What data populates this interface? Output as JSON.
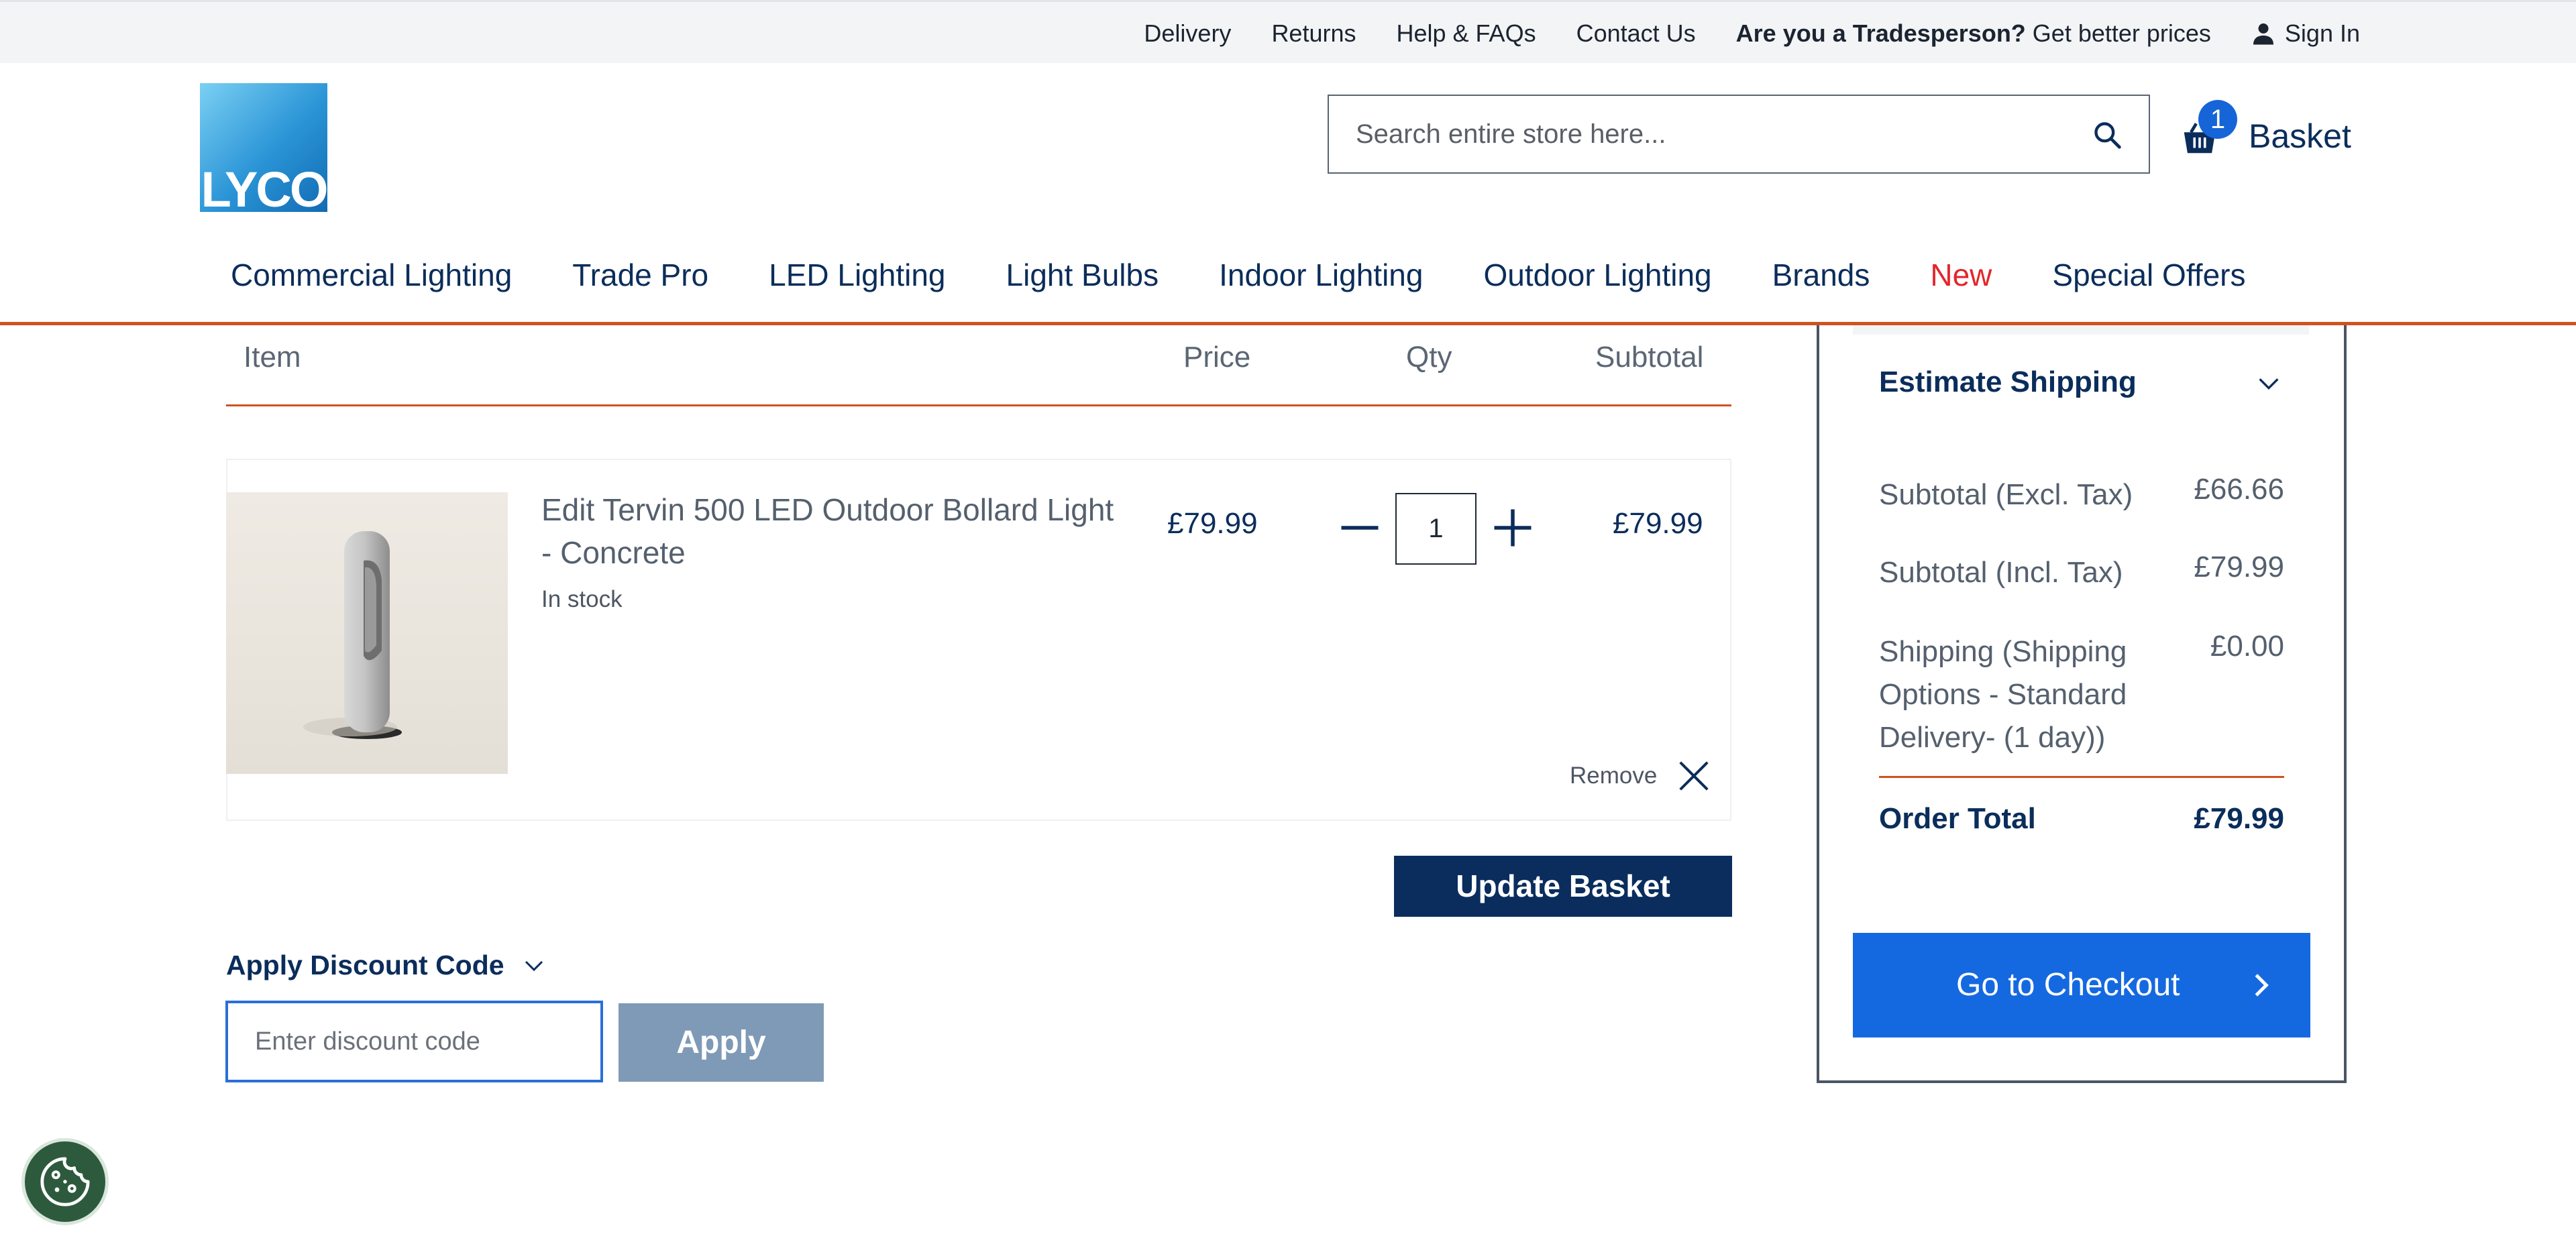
{
  "topbar": {
    "links": [
      "Delivery",
      "Returns",
      "Help & FAQs",
      "Contact Us"
    ],
    "trade_bold": "Are you a Tradesperson?",
    "trade_rest": " Get better prices",
    "sign_in": "Sign In"
  },
  "header": {
    "logo_text": "LYCO",
    "search_placeholder": "Search entire store here...",
    "basket_count": "1",
    "basket_label": "Basket"
  },
  "nav": {
    "items": [
      "Commercial Lighting",
      "Trade Pro",
      "LED Lighting",
      "Light Bulbs",
      "Indoor Lighting",
      "Outdoor Lighting",
      "Brands",
      "New",
      "Special Offers"
    ]
  },
  "cart": {
    "headers": {
      "item": "Item",
      "price": "Price",
      "qty": "Qty",
      "subtotal": "Subtotal"
    },
    "items": [
      {
        "name": "Edit Tervin 500 LED Outdoor Bollard Light - Concrete",
        "stock": "In stock",
        "price": "£79.99",
        "qty": "1",
        "subtotal": "£79.99",
        "remove_label": "Remove"
      }
    ],
    "update_label": "Update Basket",
    "discount_title": "Apply Discount Code",
    "discount_placeholder": "Enter discount code",
    "apply_label": "Apply"
  },
  "summary": {
    "estimate_shipping": "Estimate Shipping",
    "rows": [
      {
        "label": "Subtotal (Excl. Tax)",
        "value": "£66.66"
      },
      {
        "label": "Subtotal (Incl. Tax)",
        "value": "£79.99"
      },
      {
        "label": "Shipping (Shipping Options - Standard Delivery- (1 day))",
        "value": "£0.00"
      }
    ],
    "order_total_label": "Order Total",
    "order_total_value": "£79.99",
    "checkout_label": "Go to Checkout"
  },
  "colors": {
    "brand_navy": "#0b2d5b",
    "accent_orange": "#d0531f",
    "checkout_blue": "#1569e0",
    "new_red": "#e3262c"
  }
}
